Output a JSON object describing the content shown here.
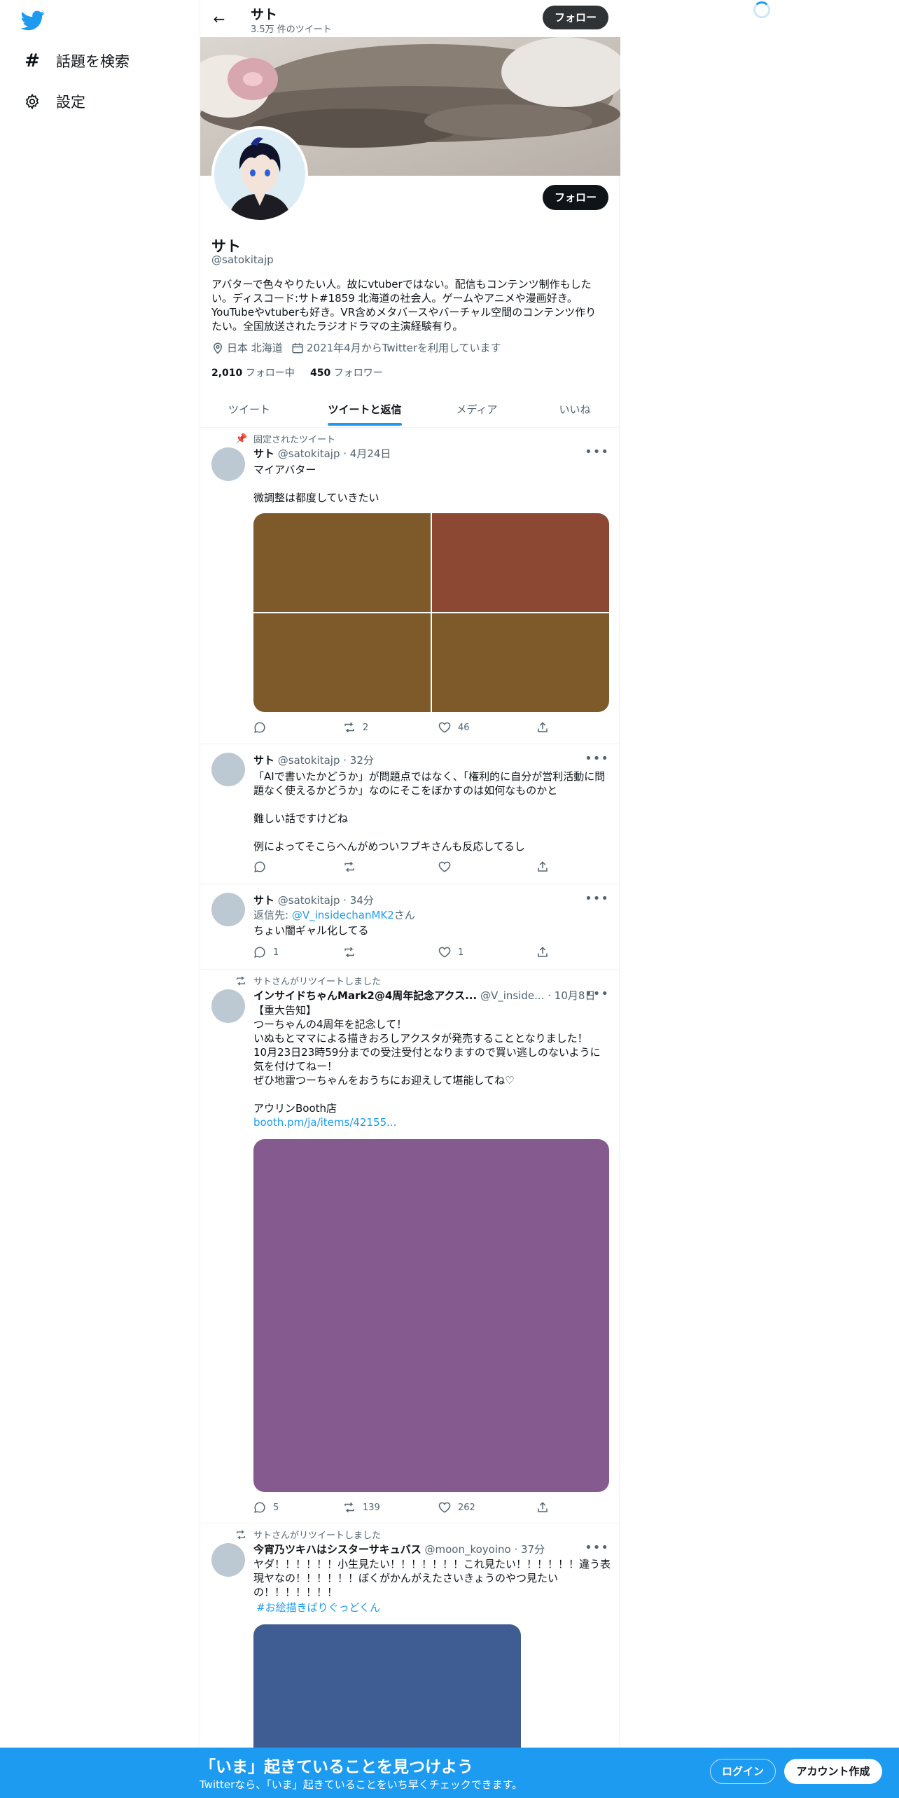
{
  "sidebar": {
    "explore_label": "話題を検索",
    "settings_label": "設定"
  },
  "header": {
    "name": "サト",
    "tweet_count": "3.5万 件のツイート",
    "follow_label": "フォロー"
  },
  "profile": {
    "name": "サト",
    "handle": "@satokitajp",
    "follow_button": "フォロー",
    "bio": "アバターで色々やりたい人。故にvtuberではない。配信もコンテンツ制作もしたい。ディスコード:サト#1859 北海道の社会人。ゲームやアニメや漫画好き。YouTubeやvtuberも好き。VR含めメタバースやバーチャル空間のコンテンツ作りたい。全国放送されたラジオドラマの主演経験有り。",
    "location": "日本 北海道",
    "joined": "2021年4月からTwitterを利用しています",
    "following_count": "2,010",
    "following_label": "フォロー中",
    "followers_count": "450",
    "followers_label": "フォロワー"
  },
  "tabs": [
    {
      "label": "ツイート",
      "active": false
    },
    {
      "label": "ツイートと返信",
      "active": true
    },
    {
      "label": "メディア",
      "active": false
    },
    {
      "label": "いいね",
      "active": false
    }
  ],
  "tweets": [
    {
      "context": "固定されたツイート",
      "name": "サト",
      "handle": "@satokitajp",
      "time": "· 4月24日",
      "text": "マイアバター\n\n微調整は都度していきたい",
      "media_colors": [
        "#7e5a2a",
        "#8c4832",
        "#7e5a2a",
        "#7e5a2a"
      ],
      "replies": "",
      "retweets": "2",
      "likes": "46"
    },
    {
      "name": "サト",
      "handle": "@satokitajp",
      "time": "· 32分",
      "text": "「AIで書いたかどうか」が問題点ではなく、「権利的に自分が営利活動に問題なく使えるかどうか」なのにそこをぼかすのは如何なものかと\n\n難しい話ですけどね\n\n例によってそこらへんがめついフブキさんも反応してるし",
      "replies": "",
      "retweets": "",
      "likes": ""
    },
    {
      "name": "サト",
      "handle": "@satokitajp",
      "time": "· 34分",
      "reply_prefix": "返信先: ",
      "reply_to": "@V_insidechanMK2",
      "reply_suffix": "さん",
      "text": "ちょい闇ギャル化してる",
      "replies": "1",
      "retweets": "",
      "likes": "1"
    },
    {
      "context": "サトさんがリツイートしました",
      "name": "インサイドちゃんMark2@4周年記念アクス...",
      "handle": "@V_inside...",
      "time": "· 10月8日",
      "text": "【重大告知】\nつーちゃんの4周年を記念して！\nいぬもとママによる描きおろしアクスタが発売することとなりました！\n10月23日23時59分までの受注受付となりますので買い逃しのないように気を付けてねー！\nぜひ地雷つーちゃんをおうちにお迎えして堪能してね♡\n\nアウリンBooth店",
      "link": "booth.pm/ja/items/42155...",
      "media_color": "#855a8e",
      "replies": "5",
      "retweets": "139",
      "likes": "262"
    },
    {
      "context": "サトさんがリツイートしました",
      "name": "今宵乃ツキハはシスターサキュバス",
      "handle": "@moon_koyoino",
      "time": "· 37分",
      "text": "ヤダ！！！！！！小生見たい！！！！！！！これ見たい！！！！！！違う表現ヤなの！！！！！！ぼくがかんがえたさいきょうのやつ見たいの！！！！！！！",
      "hashtag": "#お絵描きばりぐっどくん",
      "media_color": "#3f5c93"
    }
  ],
  "bottom_bar": {
    "title": "「いま」起きていることを見つけよう",
    "subtitle": "Twitterなら、「いま」起きていることをいち早くチェックできます。",
    "login": "ログイン",
    "signup": "アカウント作成"
  }
}
